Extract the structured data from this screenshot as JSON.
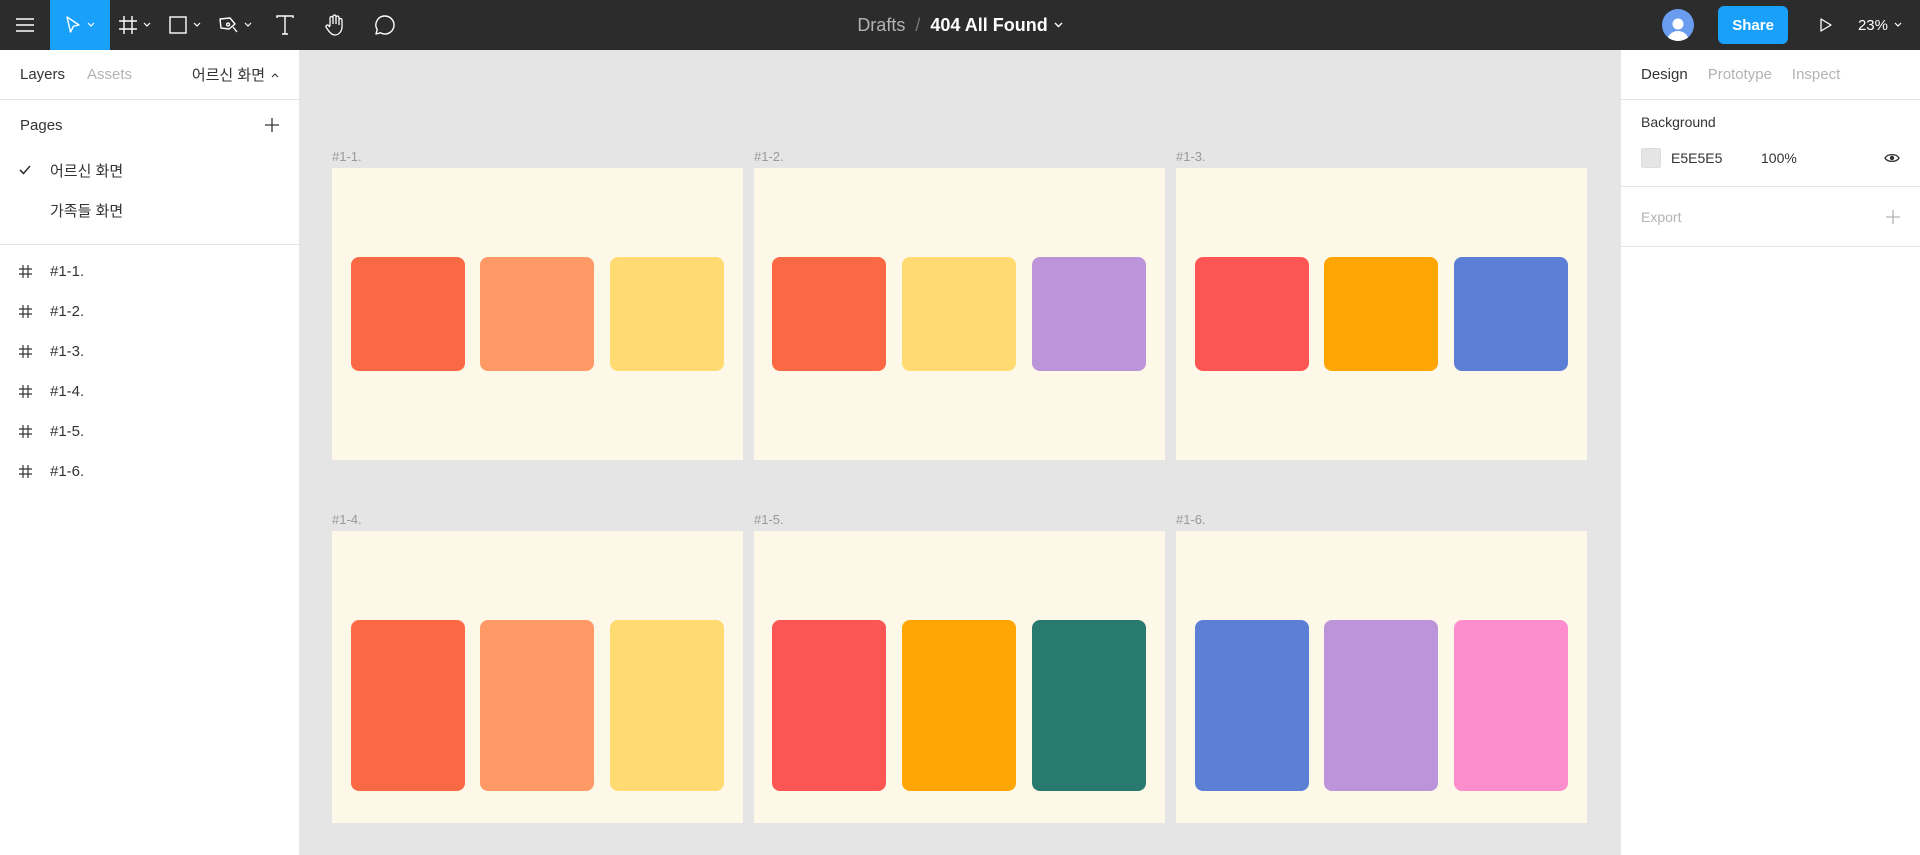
{
  "toolbar": {
    "breadcrumb": "Drafts",
    "separator": "/",
    "file_name": "404 All Found",
    "share_label": "Share",
    "zoom": "23%",
    "accent": "#18a0fb"
  },
  "left_panel": {
    "tabs": [
      "Layers",
      "Assets"
    ],
    "current_page": "어르신 화면",
    "pages_title": "Pages",
    "pages": [
      {
        "label": "어르신 화면",
        "selected": true
      },
      {
        "label": "가족들 화면",
        "selected": false
      }
    ],
    "layers": [
      "#1-1.",
      "#1-2.",
      "#1-3.",
      "#1-4.",
      "#1-5.",
      "#1-6."
    ]
  },
  "canvas": {
    "background": "#E5E5E5",
    "frames": [
      {
        "label": "#1-1.",
        "colors": [
          "#FB6944",
          "#FF9966",
          "#FFDB72"
        ]
      },
      {
        "label": "#1-2.",
        "colors": [
          "#FB6944",
          "#FFDB72",
          "#BB94DA"
        ]
      },
      {
        "label": "#1-3.",
        "colors": [
          "#FC5654",
          "#FFA604",
          "#5B7FD4"
        ]
      },
      {
        "label": "#1-4.",
        "colors": [
          "#FB6944",
          "#FF9966",
          "#FFDB72"
        ]
      },
      {
        "label": "#1-5.",
        "colors": [
          "#FC5654",
          "#FFA604",
          "#287A6E"
        ]
      },
      {
        "label": "#1-6.",
        "colors": [
          "#5B7FD4",
          "#BB94DA",
          "#FD8DCC"
        ]
      }
    ]
  },
  "right_panel": {
    "tabs": [
      "Design",
      "Prototype",
      "Inspect"
    ],
    "background_title": "Background",
    "background_hex": "E5E5E5",
    "background_opacity": "100%",
    "export_title": "Export"
  }
}
